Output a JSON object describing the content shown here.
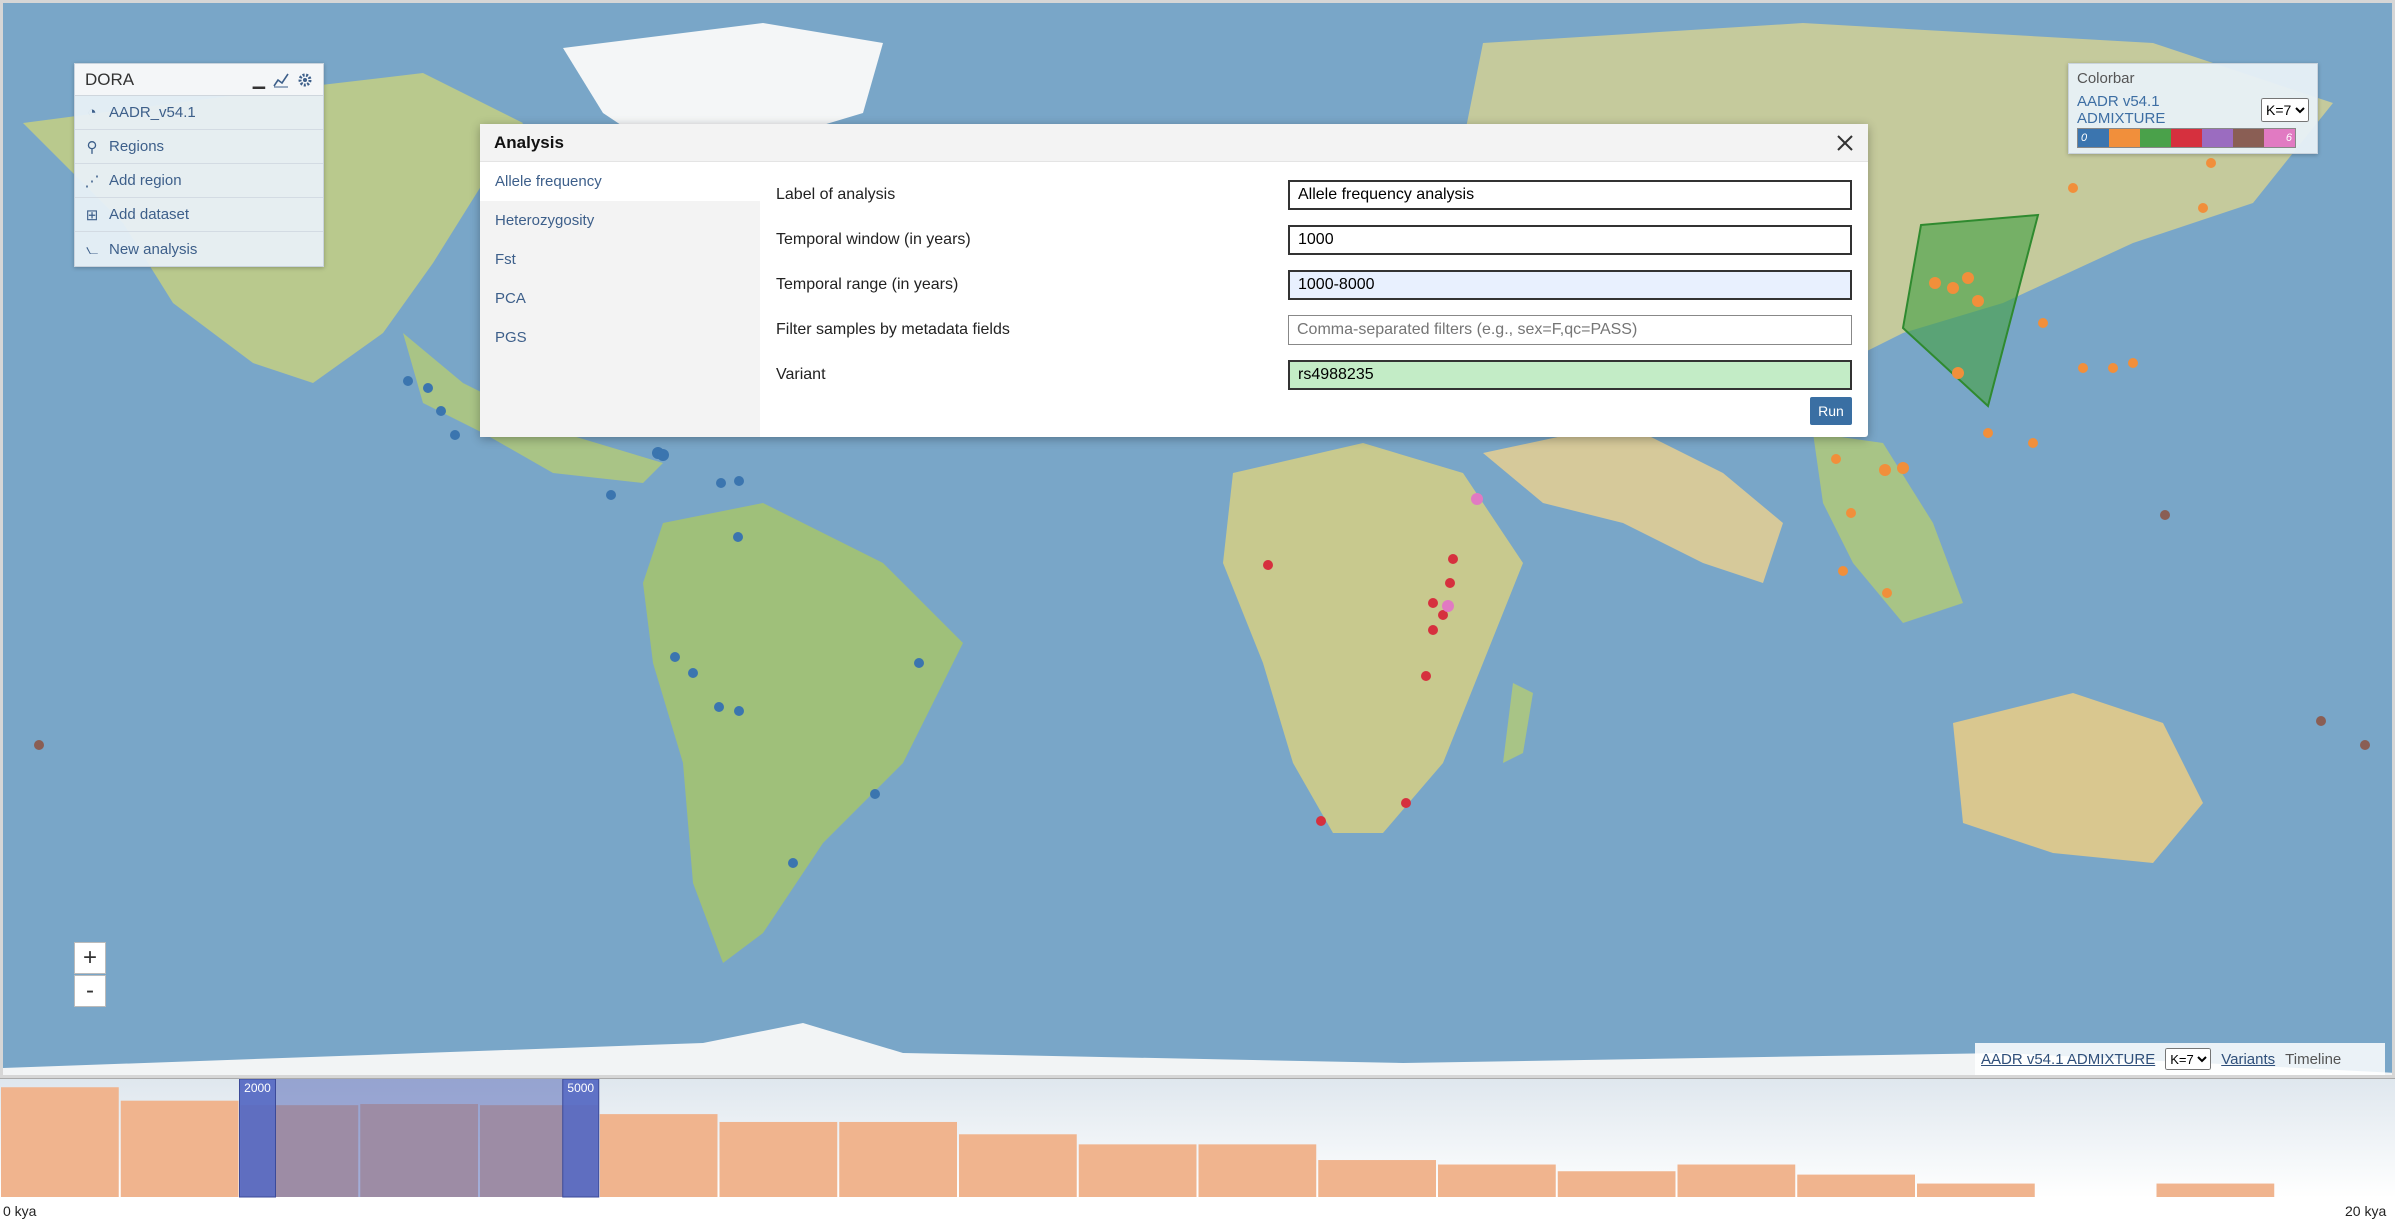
{
  "dora": {
    "title": "DORA",
    "items": [
      {
        "label": "AADR_v54.1",
        "icon": "dataset-icon"
      },
      {
        "label": "Regions",
        "icon": "pin-icon"
      },
      {
        "label": "Add region",
        "icon": "polygon-icon"
      },
      {
        "label": "Add dataset",
        "icon": "plus-square-icon"
      },
      {
        "label": "New analysis",
        "icon": "chart-icon"
      }
    ]
  },
  "colorbar": {
    "title": "Colorbar",
    "dataset": "AADR v54.1 ADMIXTURE",
    "k_value": "K=7",
    "start_label": "0",
    "end_label": "6",
    "colors": [
      "#3b75af",
      "#f18f3b",
      "#4aa14a",
      "#d6303e",
      "#9b6cc0",
      "#8a5e54",
      "#e17ac2"
    ]
  },
  "modal": {
    "title": "Analysis",
    "tabs": [
      "Allele frequency",
      "Heterozygosity",
      "Fst",
      "PCA",
      "PGS"
    ],
    "active_tab": 0,
    "fields": [
      {
        "label": "Label of analysis",
        "value": "Allele frequency analysis",
        "placeholder": ""
      },
      {
        "label": "Temporal window (in years)",
        "value": "1000",
        "placeholder": ""
      },
      {
        "label": "Temporal range (in years)",
        "value": "1000-8000",
        "placeholder": ""
      },
      {
        "label": "Filter samples by metadata fields",
        "value": "",
        "placeholder": "Comma-separated filters (e.g., sex=F,qc=PASS)"
      },
      {
        "label": "Variant",
        "value": "rs4988235",
        "placeholder": ""
      }
    ],
    "run_label": "Run"
  },
  "zoom": {
    "in": "+",
    "out": "-"
  },
  "legend": {
    "dataset": "AADR v54.1 ADMIXTURE",
    "k_value": "K=7",
    "variants": "Variants",
    "timeline": "Timeline"
  },
  "timeline": {
    "start_label": "0 kya",
    "end_label": "20 kya",
    "brush_start_label": "2000",
    "brush_end_label": "5000",
    "brush_start": 2000,
    "brush_end": 5000,
    "bars": [
      0.98,
      0.86,
      0.82,
      0.83,
      0.82,
      0.74,
      0.67,
      0.67,
      0.56,
      0.47,
      0.47,
      0.33,
      0.29,
      0.23,
      0.29,
      0.2,
      0.12,
      0,
      0.12,
      0
    ]
  }
}
